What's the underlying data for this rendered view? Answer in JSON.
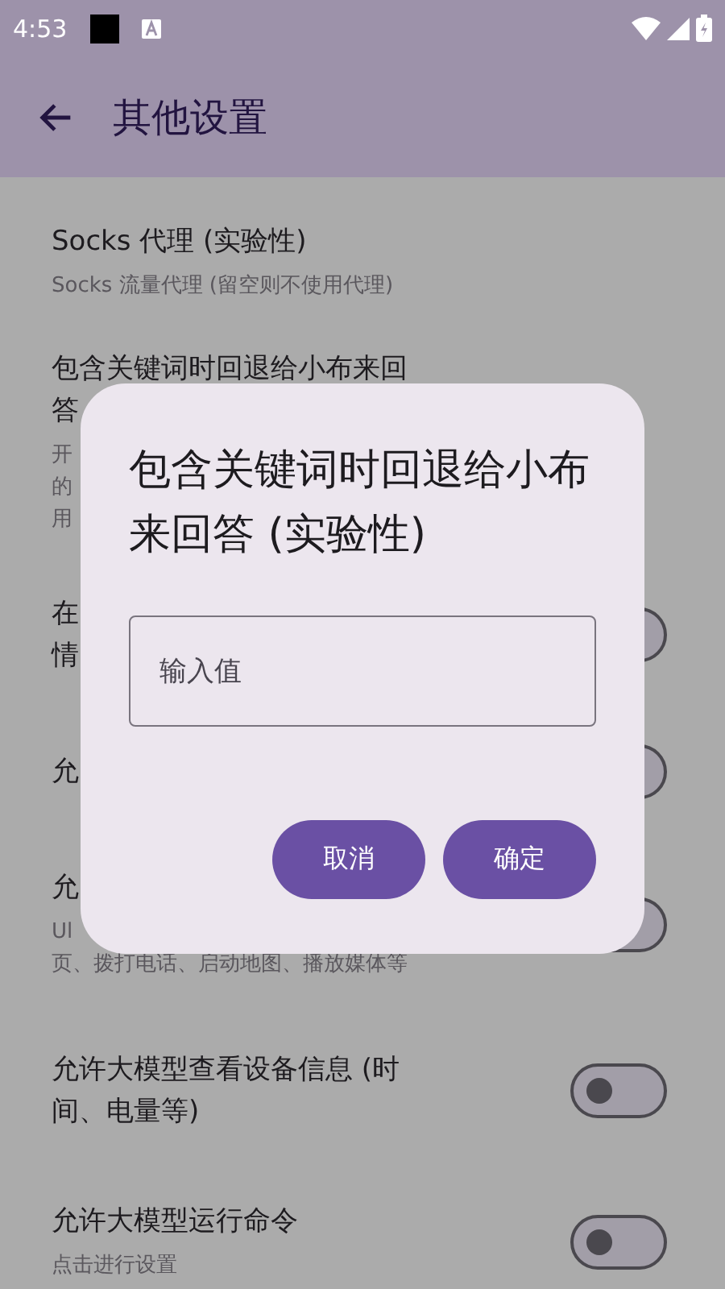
{
  "status_bar": {
    "time": "4:53"
  },
  "app_bar": {
    "title": "其他设置"
  },
  "settings": [
    {
      "kind": "text",
      "title_lines": [
        "Socks 代理 (实验性)"
      ],
      "subtitle_lines": [
        "Socks 流量代理 (留空则不使用代理)"
      ]
    },
    {
      "kind": "text",
      "title_lines": [
        "包含关键词时回退给小布来回",
        "答"
      ],
      "subtitle_lines": [
        "开",
        "的",
        "用"
      ]
    },
    {
      "kind": "switch",
      "title_lines": [
        "在",
        "情"
      ],
      "on": false
    },
    {
      "kind": "switch",
      "title_lines": [
        "允"
      ],
      "on": false
    },
    {
      "kind": "switch",
      "title_lines": [
        "允"
      ],
      "subtitle_lines": [
        "Ul",
        "页、拨打电话、启动地图、播放媒体等"
      ],
      "on": false
    },
    {
      "kind": "switch",
      "title_lines": [
        "允许大模型查看设备信息 (时",
        "间、电量等)"
      ],
      "on": false
    },
    {
      "kind": "switch",
      "title_lines": [
        "允许大模型运行命令"
      ],
      "subtitle_lines": [
        "点击进行设置"
      ],
      "on": false
    }
  ],
  "dialog": {
    "title": "包含关键词时回退给小布来回答 (实验性)",
    "input": {
      "placeholder": "输入值"
    },
    "buttons": [
      "取消",
      "确定"
    ]
  }
}
